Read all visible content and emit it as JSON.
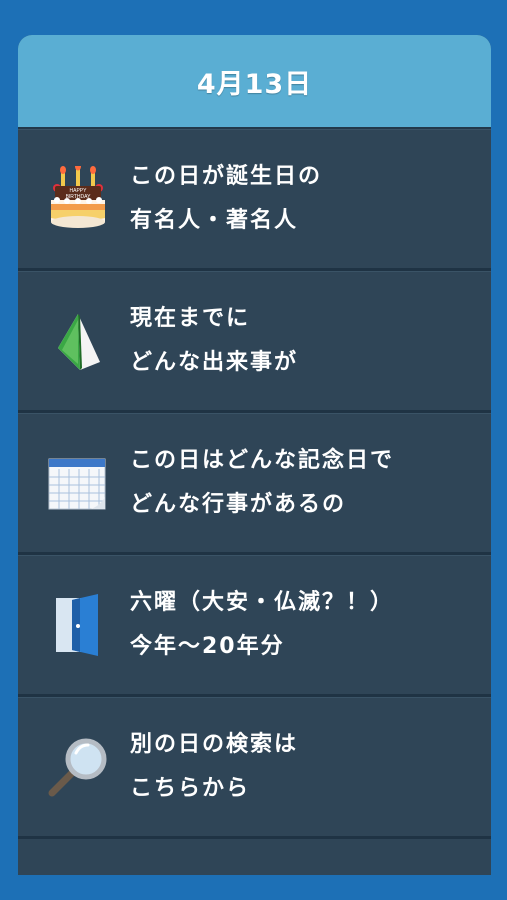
{
  "header": {
    "title": "4月13日"
  },
  "menu": {
    "items": [
      {
        "icon": "birthday-cake-icon",
        "line1": "この日が誕生日の",
        "line2": "有名人・著名人",
        "cake_text_1": "HAPPY",
        "cake_text_2": "BIRTHDAY"
      },
      {
        "icon": "book-icon",
        "line1": "現在までに",
        "line2": "どんな出来事が"
      },
      {
        "icon": "calendar-icon",
        "line1": "この日はどんな記念日で",
        "line2": "どんな行事があるの"
      },
      {
        "icon": "door-icon",
        "line1": "六曜（大安・仏滅？！）",
        "line2": "今年〜20年分"
      },
      {
        "icon": "magnifier-icon",
        "line1": "別の日の検索は",
        "line2": "こちらから"
      }
    ]
  },
  "colors": {
    "background": "#1d70b6",
    "header": "#5aaed3",
    "row": "#2f4557",
    "text": "#ffffff"
  }
}
